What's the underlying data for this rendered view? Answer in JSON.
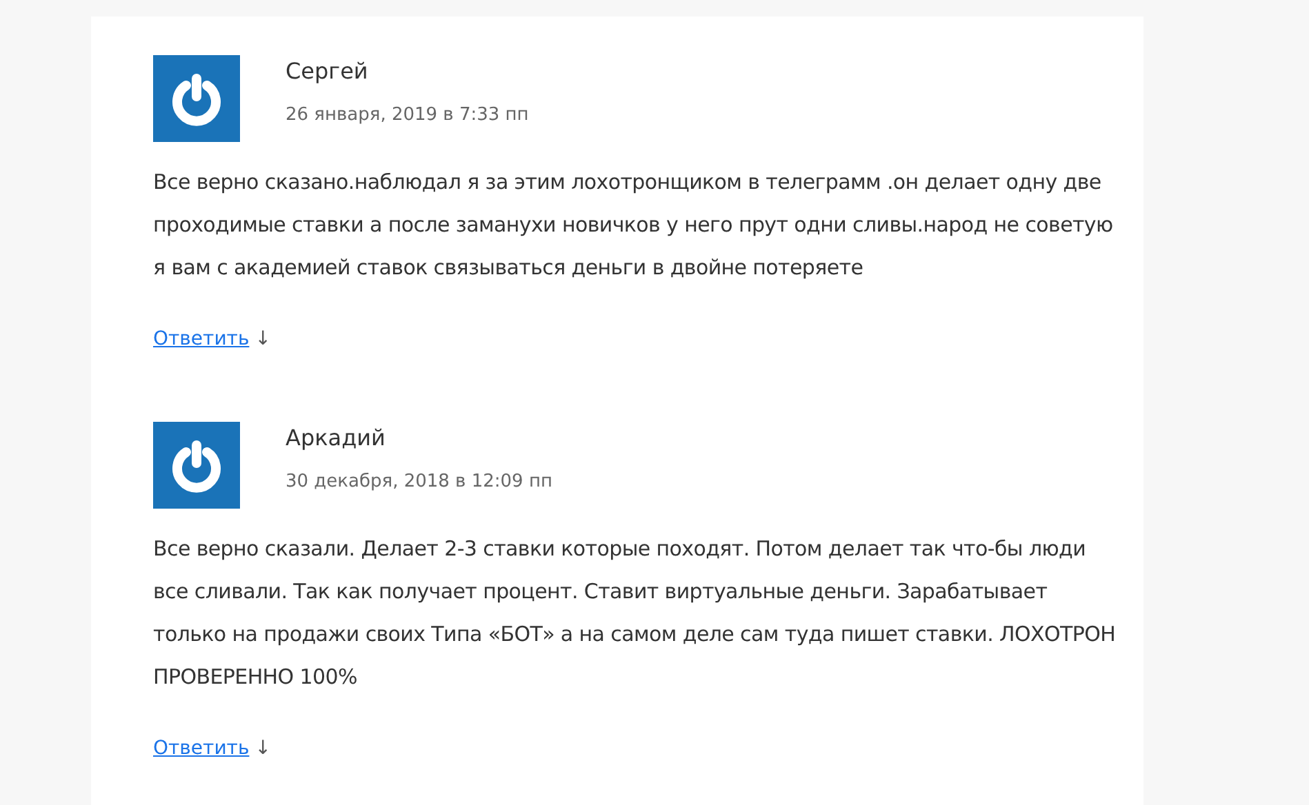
{
  "comments": [
    {
      "author": "Сергей",
      "date": "26 января, 2019 в 7:33 пп",
      "text": "Все верно сказано.наблюдал я за этим лохотронщиком в телеграмм .он делает одну две проходимые ставки а после заманухи новичков у него прут одни сливы.народ не советую я вам с академией ставок связываться деньги в двойне потеряете",
      "reply": "Ответить",
      "reply_arrow": "↓"
    },
    {
      "author": "Аркадий",
      "date": "30 декабря, 2018 в 12:09 пп",
      "text": "Все верно сказали. Делает 2-3 ставки которые походят. Потом делает так что-бы люди все сливали. Так как получает процент. Ставит виртуальные деньги. Зарабатывает только на продажи своих Типа «БОТ» а на самом деле сам туда пишет ставки. ЛОХОТРОН ПРОВЕРЕННО 100%",
      "reply": "Ответить",
      "reply_arrow": "↓"
    }
  ]
}
